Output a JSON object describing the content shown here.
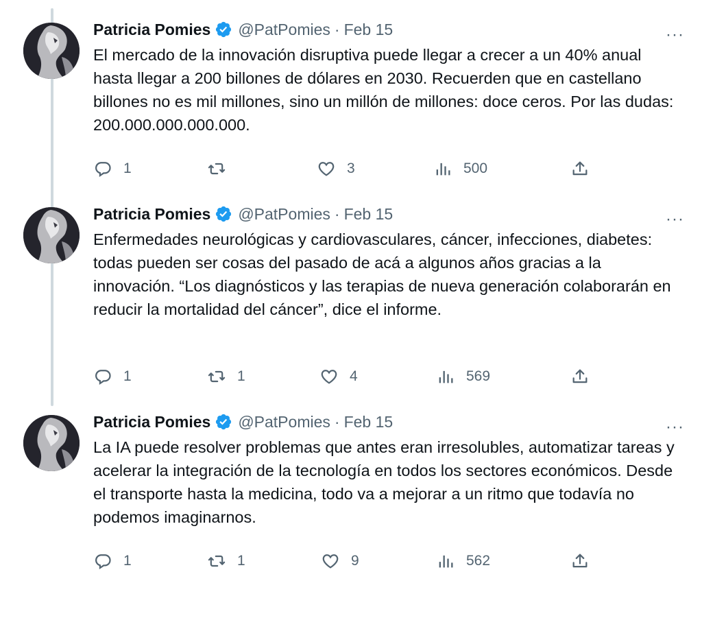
{
  "tweets": [
    {
      "name": "Patricia Pomies",
      "handle": "@PatPomies",
      "separator": "·",
      "date": "Feb 15",
      "more_icon": "···",
      "text": "El mercado de la innovación disruptiva puede llegar a crecer a un 40% anual hasta llegar a 200 billones de dólares en 2030. Recuerden que en castellano billones no es mil millones, sino un millón de millones: doce ceros. Por las dudas: 200.000.000.000.000.",
      "replies": "1",
      "retweets": "",
      "likes": "3",
      "views": "500"
    },
    {
      "name": "Patricia Pomies",
      "handle": "@PatPomies",
      "separator": "·",
      "date": "Feb 15",
      "more_icon": "···",
      "text": "Enfermedades neurológicas y cardiovasculares, cáncer, infecciones, diabetes: todas pueden ser cosas del pasado de acá a algunos años gracias a la innovación. “Los diagnósticos y las terapias de nueva generación colaborarán en reducir la mortalidad del cáncer”, dice el informe.",
      "replies": "1",
      "retweets": "1",
      "likes": "4",
      "views": "569"
    },
    {
      "name": "Patricia Pomies",
      "handle": "@PatPomies",
      "separator": "·",
      "date": "Feb 15",
      "more_icon": "···",
      "text": "La IA puede resolver problemas que antes eran irresolubles, automatizar tareas y acelerar la integración de la tecnología en todos los sectores económicos. Desde el transporte hasta la medicina, todo va a mejorar a un ritmo que todavía no podemos imaginarnos.",
      "replies": "1",
      "retweets": "1",
      "likes": "9",
      "views": "562"
    }
  ],
  "colors": {
    "text": "#0f1419",
    "muted": "#536471",
    "verified": "#1d9bf0",
    "thread_line": "#cfd9de"
  },
  "icons": {
    "reply": "reply-icon",
    "retweet": "retweet-icon",
    "like": "heart-icon",
    "views": "views-icon",
    "share": "share-icon",
    "verified": "verified-badge-icon",
    "more": "more-icon"
  }
}
